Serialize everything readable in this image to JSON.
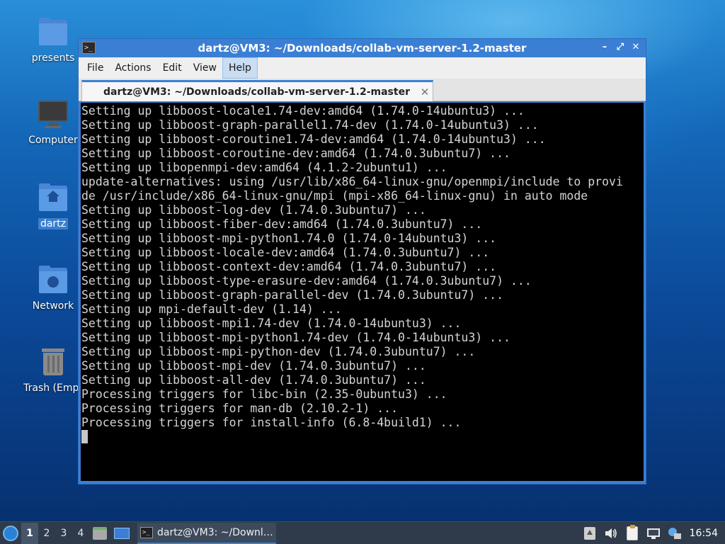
{
  "desktop": {
    "icons": [
      {
        "label": "presents",
        "icon": "folder-icon"
      },
      {
        "label": "Computer",
        "icon": "computer-icon"
      },
      {
        "label": "dartz",
        "icon": "home-folder-icon"
      },
      {
        "label": "Network",
        "icon": "network-folder-icon"
      },
      {
        "label": "Trash (Empt",
        "icon": "trash-icon"
      }
    ]
  },
  "window": {
    "title": "dartz@VM3: ~/Downloads/collab-vm-server-1.2-master",
    "controls": {
      "minimize": "–",
      "maximize": "⤢",
      "close": "✕"
    },
    "menu": [
      "File",
      "Actions",
      "Edit",
      "View",
      "Help"
    ],
    "active_menu": "Help",
    "tab": {
      "label": "dartz@VM3: ~/Downloads/collab-vm-server-1.2-master",
      "close": "✕"
    }
  },
  "terminal": {
    "lines": [
      "Setting up libboost-locale1.74-dev:amd64 (1.74.0-14ubuntu3) ...",
      "Setting up libboost-graph-parallel1.74-dev (1.74.0-14ubuntu3) ...",
      "Setting up libboost-coroutine1.74-dev:amd64 (1.74.0-14ubuntu3) ...",
      "Setting up libboost-coroutine-dev:amd64 (1.74.0.3ubuntu7) ...",
      "Setting up libopenmpi-dev:amd64 (4.1.2-2ubuntu1) ...",
      "update-alternatives: using /usr/lib/x86_64-linux-gnu/openmpi/include to provi",
      "de /usr/include/x86_64-linux-gnu/mpi (mpi-x86_64-linux-gnu) in auto mode",
      "Setting up libboost-log-dev (1.74.0.3ubuntu7) ...",
      "Setting up libboost-fiber-dev:amd64 (1.74.0.3ubuntu7) ...",
      "Setting up libboost-mpi-python1.74.0 (1.74.0-14ubuntu3) ...",
      "Setting up libboost-locale-dev:amd64 (1.74.0.3ubuntu7) ...",
      "Setting up libboost-context-dev:amd64 (1.74.0.3ubuntu7) ...",
      "Setting up libboost-type-erasure-dev:amd64 (1.74.0.3ubuntu7) ...",
      "Setting up libboost-graph-parallel-dev (1.74.0.3ubuntu7) ...",
      "Setting up mpi-default-dev (1.14) ...",
      "Setting up libboost-mpi1.74-dev (1.74.0-14ubuntu3) ...",
      "Setting up libboost-mpi-python1.74-dev (1.74.0-14ubuntu3) ...",
      "Setting up libboost-mpi-python-dev (1.74.0.3ubuntu7) ...",
      "Setting up libboost-mpi-dev (1.74.0.3ubuntu7) ...",
      "Setting up libboost-all-dev (1.74.0.3ubuntu7) ...",
      "Processing triggers for libc-bin (2.35-0ubuntu3) ...",
      "Processing triggers for man-db (2.10.2-1) ...",
      "Processing triggers for install-info (6.8-4build1) ..."
    ]
  },
  "taskbar": {
    "workspaces": [
      "1",
      "2",
      "3",
      "4"
    ],
    "active_workspace": "1",
    "task_label": "dartz@VM3: ~/Downl…",
    "clock": "16:54",
    "tray_icons": [
      "updates-icon",
      "volume-icon",
      "clipboard-icon",
      "network-display-icon",
      "update-notifier-icon"
    ]
  },
  "colors": {
    "accent": "#3a7fd4",
    "terminal_bg": "#000000",
    "terminal_fg": "#d4d4d4",
    "taskbar_bg": "#2f3b4a"
  }
}
